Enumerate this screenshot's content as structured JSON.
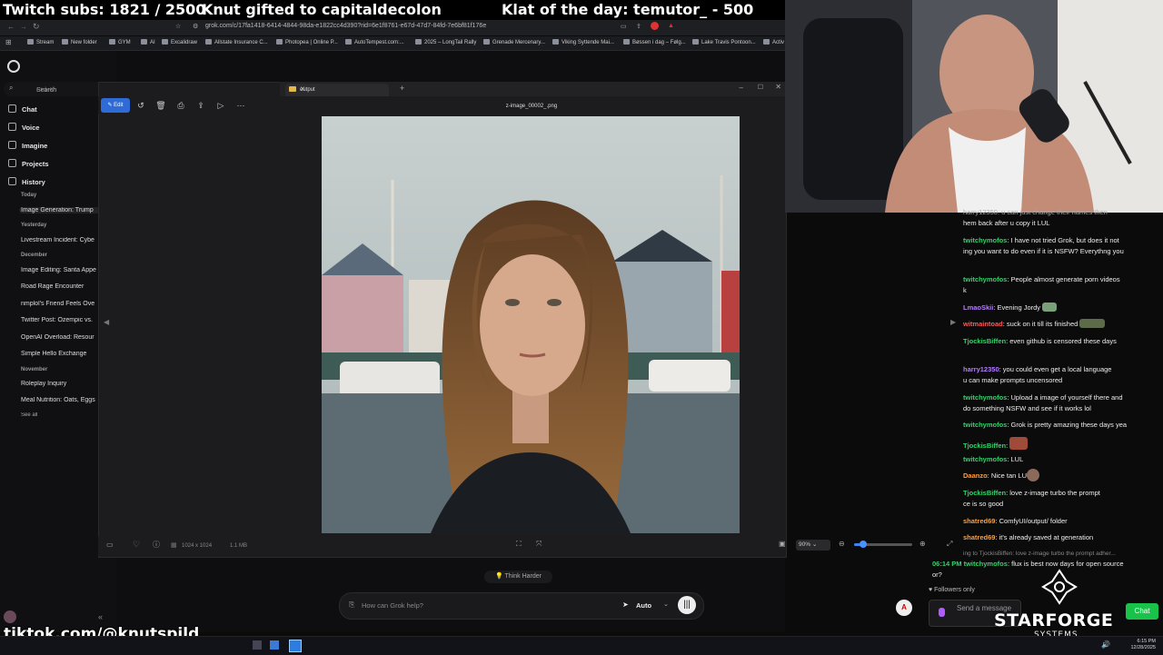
{
  "overlay": {
    "subs": "Twitch subs: 1821 / 2500",
    "gift": "Knut gifted to capitaldecolon",
    "klat": "Klat of the day: temutor_ - 500",
    "tiktok": "tiktok.com/@knutspild",
    "brand": "STARFORGE",
    "brand_sub": "SYSTEMS"
  },
  "browser": {
    "url": "grok.com/c/17fa1418-6414-4844-98da-e1822cc4d390?rid=6e1f8761-e67d-47d7-84fd-7e6bf81f176e",
    "bookmarks": [
      "Stream",
      "New folder",
      "GYM",
      "AI",
      "Excalidraw",
      "Allstate Insurance C...",
      "Photopea | Online P...",
      "AutoTempest.com:...",
      "2025 – LongTail Rally",
      "Grenade Mercenary...",
      "Viking Syttende Mai...",
      "Bøssen i dag – Følg...",
      "Lake Travis Pontoon...",
      "Activ"
    ]
  },
  "grok": {
    "search_label": "Search",
    "search_shortcut": "Ctrl+K",
    "nav": [
      "Chat",
      "Voice",
      "Imagine",
      "Projects",
      "History"
    ],
    "sections": {
      "today": "Today",
      "yesterday": "Yesterday",
      "december": "December",
      "november": "November"
    },
    "history_today": [
      "Image Generation: Trump"
    ],
    "history_yesterday": [
      "Livestream Incident: Cybe"
    ],
    "history_december": [
      "Image Editing: Santa Appe",
      "Road Rage Encounter",
      "nmplol's Friend Feels Ove",
      "Twitter Post: Ozempic vs.",
      "OpenAI Overload: Resour",
      "Simple Hello Exchange"
    ],
    "history_november": [
      "Roleplay Inquiry",
      "Meal Nutrition: Oats, Eggs"
    ],
    "see_all": "See all",
    "think_harder": "Think Harder",
    "chat_placeholder": "How can Grok help?",
    "mode": "Auto"
  },
  "viewer": {
    "tab_title": "output",
    "edit_label": "Edit",
    "file_name": "z-image_00002_.png",
    "dimensions": "1024 x 1024",
    "file_size": "1.1 MB",
    "zoom": "90%",
    "zoom_level": 0.15
  },
  "chat": {
    "messages": [
      {
        "user": "",
        "color": "#eeeeee",
        "text": "harry12350: u can just change their names then"
      },
      {
        "user": "",
        "color": "#eeeeee",
        "text": "hem back after u copy it LUL"
      },
      {
        "user": "twitchymofos",
        "color": "#34d26b",
        "text": ": I have not tried Grok, but does it not"
      },
      {
        "user": "",
        "color": "#eeeeee",
        "text": "ing you want to do even if it is NSFW? Everythng you"
      },
      {
        "user": "twitchymofos",
        "color": "#34d26b",
        "text": ": People almost generate porn videos"
      },
      {
        "user": "",
        "color": "#eeeeee",
        "text": "k"
      },
      {
        "user": "LmaoSkii",
        "color": "#b57cff",
        "text": ": Evening Jordy"
      },
      {
        "user": "witmaintoad",
        "color": "#ff5a5a",
        "text": ": suck on it till its finished"
      },
      {
        "user": "TjockisBiffen",
        "color": "#34d26b",
        "text": ": even github is censored these days"
      },
      {
        "user": "harry12350",
        "color": "#b57cff",
        "text": ": you could even get a local language"
      },
      {
        "user": "",
        "color": "#eeeeee",
        "text": "u can make prompts uncensored"
      },
      {
        "user": "twitchymofos",
        "color": "#34d26b",
        "text": ": Upload a image of yourself there and"
      },
      {
        "user": "",
        "color": "#eeeeee",
        "text": "do something NSFW and see if it works lol"
      },
      {
        "user": "twitchymofos",
        "color": "#34d26b",
        "text": ": Grok is pretty amazing these days yea"
      },
      {
        "user": "TjockisBiffen",
        "color": "#34d26b",
        "text": ":"
      },
      {
        "user": "twitchymofos",
        "color": "#34d26b",
        "text": ": LUL"
      },
      {
        "user": "Daanzo",
        "color": "#ff9f3a",
        "text": ": Nice tan        LUL"
      },
      {
        "user": "TjockisBiffen",
        "color": "#34d26b",
        "text": ": love z-image turbo the prompt"
      },
      {
        "user": "",
        "color": "#eeeeee",
        "text": "ce is so good"
      },
      {
        "user": "shatred69",
        "color": "#ff9f3a",
        "text": ": ComfyUI/output/ folder"
      },
      {
        "user": "shatred69",
        "color": "#ff9f3a",
        "text": ": it's already saved at generation"
      },
      {
        "user": "",
        "color": "#888888",
        "text": "ing to TjockisBiffen: love z-image turbo the prompt adher..."
      },
      {
        "user": "06:14 PM  twitchymofos",
        "color": "#34d26b",
        "text": ": flux is best now days for open source"
      },
      {
        "user": "",
        "color": "#eeeeee",
        "text": "or?"
      }
    ],
    "followers_only": "Followers only",
    "send_placeholder": "Send a message",
    "chat_button": "Chat"
  },
  "taskbar": {
    "time": "6:15 PM",
    "date": "12/28/2025"
  }
}
